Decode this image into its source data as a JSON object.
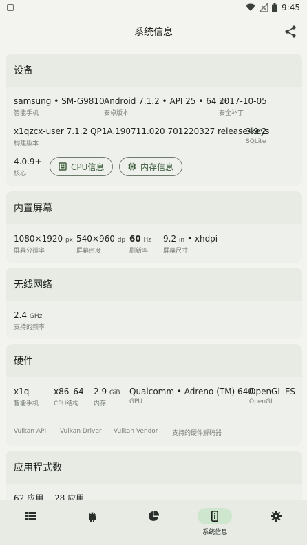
{
  "status_bar": {
    "time": "9:45"
  },
  "header": {
    "title": "系统信息"
  },
  "device": {
    "title": "设备",
    "brand_model": "samsung • SM-G9810",
    "brand_model_label": "智能手机",
    "android_version": "Android 7.1.2 • API 25 • 64",
    "android_bit_unit": "bit",
    "android_label": "安卓版本",
    "patch": "2017-10-05",
    "patch_label": "安全补丁",
    "build": "x1qzcx-user 7.1.2 QP1A.190711.020 701220327 release-keys",
    "build_label": "构建版本",
    "sqlite": "3.9.2",
    "sqlite_label": "SQLite",
    "kernel": "4.0.9+",
    "kernel_label": "核心",
    "cpu_button": "CPU信息",
    "memory_button": "内存信息"
  },
  "display": {
    "title": "内置屏幕",
    "resolution": "1080×1920",
    "resolution_unit": "px",
    "resolution_label": "屏幕分辨率",
    "density": "540×960",
    "density_unit": "dp",
    "density_label": "屏幕密度",
    "refresh": "60",
    "refresh_unit": "Hz",
    "refresh_label": "刷新率",
    "size": "9.2",
    "size_unit": "in",
    "size_suffix": "• xhdpi",
    "size_label": "屏幕尺寸"
  },
  "wireless": {
    "title": "无线网络",
    "freq": "2.4",
    "freq_unit": "GHz",
    "freq_label": "支持的频率"
  },
  "hardware": {
    "title": "硬件",
    "device": "x1q",
    "device_label": "智能手机",
    "cpu_arch": "x86_64",
    "cpu_arch_label": "CPU结构",
    "memory": "2.9",
    "memory_unit": "GiB",
    "memory_label": "内存",
    "gpu": "Qualcomm • Adreno (TM) 640",
    "gpu_label": "GPU",
    "opengl": "OpenGL ES",
    "opengl_label": "OpenGL",
    "vulkan_api_label": "Vulkan API",
    "vulkan_driver_label": "Vulkan Driver",
    "vulkan_vendor_label": "Vulkan Vendor",
    "decoders_label": "支持的硬件解码器"
  },
  "apps": {
    "title": "应用程式数",
    "user_apps": "62 应用",
    "system_apps": "28 应用"
  },
  "bottom_nav": {
    "items": [
      {
        "label": "",
        "icon": "list-icon"
      },
      {
        "label": "",
        "icon": "android-icon"
      },
      {
        "label": "",
        "icon": "pie-chart-icon"
      },
      {
        "label": "系统信息",
        "icon": "phone-info-icon"
      },
      {
        "label": "",
        "icon": "settings-icon"
      }
    ]
  },
  "colors": {
    "background": "#f3f3ef",
    "card": "#e7ebe4",
    "accent": "#3b5a3a",
    "nav_active": "#cde6cd"
  }
}
